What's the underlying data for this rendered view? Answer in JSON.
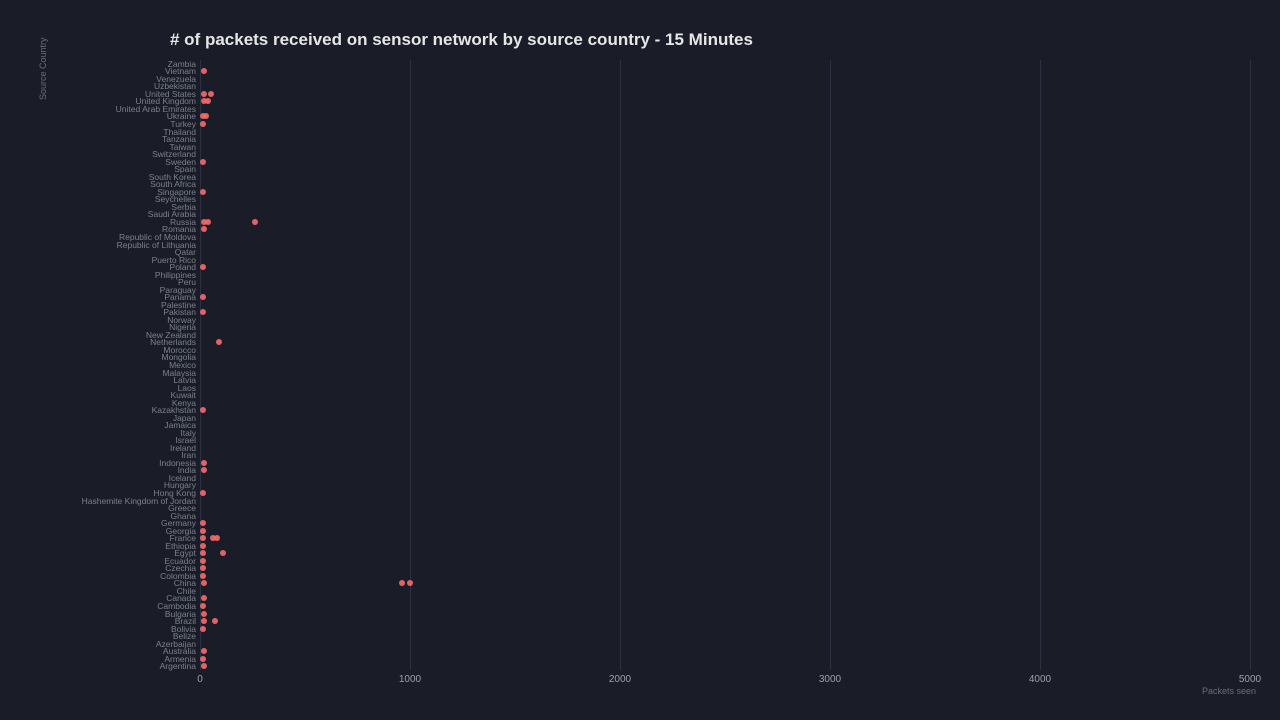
{
  "chart_data": {
    "type": "scatter",
    "title": "# of packets received on sensor network by source country - 15 Minutes",
    "ylabel": "Source Country",
    "xlabel": "Packets seen",
    "xlim": [
      0,
      5000
    ],
    "xticks": [
      0,
      1000,
      2000,
      3000,
      4000,
      5000
    ],
    "categories": [
      "Argentina",
      "Armenia",
      "Australia",
      "Azerbaijan",
      "Belize",
      "Bolivia",
      "Brazil",
      "Bulgaria",
      "Cambodia",
      "Canada",
      "Chile",
      "China",
      "Colombia",
      "Czechia",
      "Ecuador",
      "Egypt",
      "Ethiopia",
      "France",
      "Georgia",
      "Germany",
      "Ghana",
      "Greece",
      "Hashemite Kingdom of Jordan",
      "Hong Kong",
      "Hungary",
      "Iceland",
      "India",
      "Indonesia",
      "Iran",
      "Ireland",
      "Israel",
      "Italy",
      "Jamaica",
      "Japan",
      "Kazakhstan",
      "Kenya",
      "Kuwait",
      "Laos",
      "Latvia",
      "Malaysia",
      "Mexico",
      "Mongolia",
      "Morocco",
      "Netherlands",
      "New Zealand",
      "Nigeria",
      "Norway",
      "Pakistan",
      "Palestine",
      "Panama",
      "Paraguay",
      "Peru",
      "Philippines",
      "Poland",
      "Puerto Rico",
      "Qatar",
      "Republic of Lithuania",
      "Republic of Moldova",
      "Romania",
      "Russia",
      "Saudi Arabia",
      "Serbia",
      "Seychelles",
      "Singapore",
      "South Africa",
      "South Korea",
      "Spain",
      "Sweden",
      "Switzerland",
      "Taiwan",
      "Tanzania",
      "Thailand",
      "Turkey",
      "Ukraine",
      "United Arab Emirates",
      "United Kingdom",
      "United States",
      "Uzbekistan",
      "Venezuela",
      "Vietnam",
      "Zambia"
    ],
    "series": [
      {
        "name": "packets",
        "points": [
          {
            "y": "Argentina",
            "x": [
              20
            ]
          },
          {
            "y": "Armenia",
            "x": [
              15
            ]
          },
          {
            "y": "Australia",
            "x": [
              20
            ]
          },
          {
            "y": "Azerbaijan",
            "x": []
          },
          {
            "y": "Belize",
            "x": []
          },
          {
            "y": "Bolivia",
            "x": [
              15
            ]
          },
          {
            "y": "Brazil",
            "x": [
              20,
              70
            ]
          },
          {
            "y": "Bulgaria",
            "x": [
              20
            ]
          },
          {
            "y": "Cambodia",
            "x": [
              15
            ]
          },
          {
            "y": "Canada",
            "x": [
              20
            ]
          },
          {
            "y": "Chile",
            "x": []
          },
          {
            "y": "China",
            "x": [
              20,
              960,
              1000
            ]
          },
          {
            "y": "Colombia",
            "x": [
              15
            ]
          },
          {
            "y": "Czechia",
            "x": [
              15
            ]
          },
          {
            "y": "Ecuador",
            "x": [
              15
            ]
          },
          {
            "y": "Egypt",
            "x": [
              15,
              110
            ]
          },
          {
            "y": "Ethiopia",
            "x": [
              15
            ]
          },
          {
            "y": "France",
            "x": [
              15,
              60,
              80
            ]
          },
          {
            "y": "Georgia",
            "x": [
              15
            ]
          },
          {
            "y": "Germany",
            "x": [
              15
            ]
          },
          {
            "y": "Ghana",
            "x": []
          },
          {
            "y": "Greece",
            "x": []
          },
          {
            "y": "Hashemite Kingdom of Jordan",
            "x": []
          },
          {
            "y": "Hong Kong",
            "x": [
              15
            ]
          },
          {
            "y": "Hungary",
            "x": []
          },
          {
            "y": "Iceland",
            "x": []
          },
          {
            "y": "India",
            "x": [
              20
            ]
          },
          {
            "y": "Indonesia",
            "x": [
              20
            ]
          },
          {
            "y": "Iran",
            "x": []
          },
          {
            "y": "Ireland",
            "x": []
          },
          {
            "y": "Israel",
            "x": []
          },
          {
            "y": "Italy",
            "x": []
          },
          {
            "y": "Jamaica",
            "x": []
          },
          {
            "y": "Japan",
            "x": []
          },
          {
            "y": "Kazakhstan",
            "x": [
              15
            ]
          },
          {
            "y": "Kenya",
            "x": []
          },
          {
            "y": "Kuwait",
            "x": []
          },
          {
            "y": "Laos",
            "x": []
          },
          {
            "y": "Latvia",
            "x": []
          },
          {
            "y": "Malaysia",
            "x": []
          },
          {
            "y": "Mexico",
            "x": []
          },
          {
            "y": "Mongolia",
            "x": []
          },
          {
            "y": "Morocco",
            "x": []
          },
          {
            "y": "Netherlands",
            "x": [
              90
            ]
          },
          {
            "y": "New Zealand",
            "x": []
          },
          {
            "y": "Nigeria",
            "x": []
          },
          {
            "y": "Norway",
            "x": []
          },
          {
            "y": "Pakistan",
            "x": [
              15
            ]
          },
          {
            "y": "Palestine",
            "x": []
          },
          {
            "y": "Panama",
            "x": [
              15
            ]
          },
          {
            "y": "Paraguay",
            "x": []
          },
          {
            "y": "Peru",
            "x": []
          },
          {
            "y": "Philippines",
            "x": []
          },
          {
            "y": "Poland",
            "x": [
              15
            ]
          },
          {
            "y": "Puerto Rico",
            "x": []
          },
          {
            "y": "Qatar",
            "x": []
          },
          {
            "y": "Republic of Lithuania",
            "x": []
          },
          {
            "y": "Republic of Moldova",
            "x": []
          },
          {
            "y": "Romania",
            "x": [
              20
            ]
          },
          {
            "y": "Russia",
            "x": [
              20,
              40,
              260
            ]
          },
          {
            "y": "Saudi Arabia",
            "x": []
          },
          {
            "y": "Serbia",
            "x": []
          },
          {
            "y": "Seychelles",
            "x": []
          },
          {
            "y": "Singapore",
            "x": [
              15
            ]
          },
          {
            "y": "South Africa",
            "x": []
          },
          {
            "y": "South Korea",
            "x": []
          },
          {
            "y": "Spain",
            "x": []
          },
          {
            "y": "Sweden",
            "x": [
              15
            ]
          },
          {
            "y": "Switzerland",
            "x": []
          },
          {
            "y": "Taiwan",
            "x": []
          },
          {
            "y": "Tanzania",
            "x": []
          },
          {
            "y": "Thailand",
            "x": []
          },
          {
            "y": "Turkey",
            "x": [
              15
            ]
          },
          {
            "y": "Ukraine",
            "x": [
              15,
              30
            ]
          },
          {
            "y": "United Arab Emirates",
            "x": []
          },
          {
            "y": "United Kingdom",
            "x": [
              20,
              40
            ]
          },
          {
            "y": "United States",
            "x": [
              20,
              50
            ]
          },
          {
            "y": "Uzbekistan",
            "x": []
          },
          {
            "y": "Venezuela",
            "x": []
          },
          {
            "y": "Vietnam",
            "x": [
              20
            ]
          },
          {
            "y": "Zambia",
            "x": []
          }
        ]
      }
    ]
  }
}
